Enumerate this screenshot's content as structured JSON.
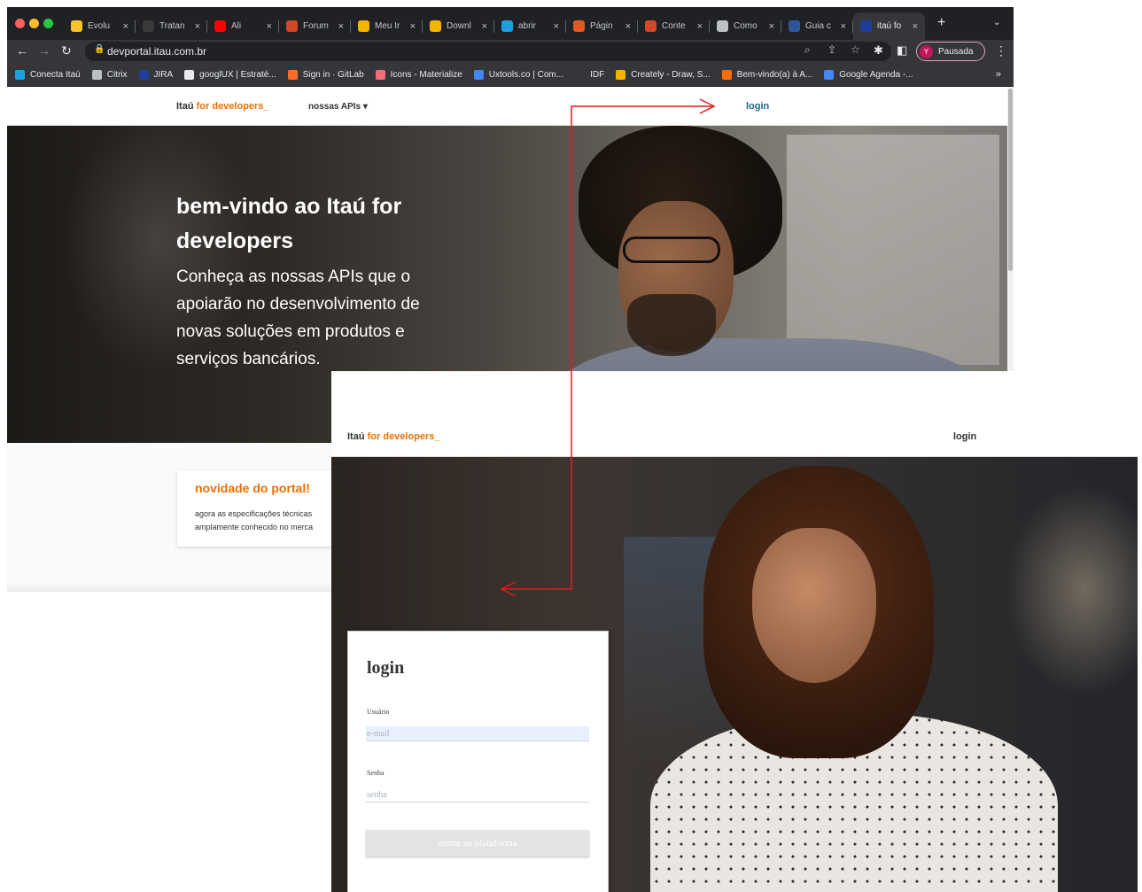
{
  "browser": {
    "tabs": [
      {
        "title": "Evolu",
        "favicon": "#f7c52b",
        "active": false
      },
      {
        "title": "Tratan",
        "favicon": "#3a3a3a",
        "active": false
      },
      {
        "title": "Ali",
        "favicon": "#ff0000",
        "active": false
      },
      {
        "title": "Forum",
        "favicon": "#d24726",
        "active": false
      },
      {
        "title": "Meu Ir",
        "favicon": "#f4b400",
        "active": false
      },
      {
        "title": "Downl",
        "favicon": "#f4b400",
        "active": false
      },
      {
        "title": "abrir",
        "favicon": "#1ba1e2",
        "active": false
      },
      {
        "title": "Págin",
        "favicon": "#e25822",
        "active": false
      },
      {
        "title": "Conte",
        "favicon": "#d24726",
        "active": false
      },
      {
        "title": "Como",
        "favicon": "#bdc1c6",
        "active": false
      },
      {
        "title": "Guia c",
        "favicon": "#2b579a",
        "active": false
      },
      {
        "title": "itaú fo",
        "favicon": "#1d3e9b",
        "active": true
      }
    ],
    "close_glyph": "×",
    "new_tab_glyph": "+",
    "tab_menu_glyph": "⌄",
    "url": "devportal.itau.com.br",
    "profile_initial": "Y",
    "profile_label": "Pausada",
    "bookmarks": [
      {
        "label": "Conecta Itaú",
        "color": "#1ba1e2"
      },
      {
        "label": "Citrix",
        "color": "#bdc1c6"
      },
      {
        "label": "JIRA",
        "color": "#1d3e9b"
      },
      {
        "label": "googlUX | Estraté...",
        "color": "#e8eaed"
      },
      {
        "label": "Sign in · GitLab",
        "color": "#fc6d26"
      },
      {
        "label": "Icons - Materialize",
        "color": "#ee6e73"
      },
      {
        "label": "Uxtools.co | Com...",
        "color": "#4285f4"
      },
      {
        "label": "IDF",
        "color": "#35363a"
      },
      {
        "label": "Creately - Draw, S...",
        "color": "#f4b400"
      },
      {
        "label": "Bem-vindo(a) à A...",
        "color": "#ff6d00"
      },
      {
        "label": "Google Agenda -...",
        "color": "#4285f4"
      }
    ],
    "bookmarks_more": "»"
  },
  "site": {
    "brand_prefix": "Itaú",
    "brand_suffix": "for developers_",
    "nav_apis": "nossas APIs ▾",
    "login_link": "login",
    "hero_title": "bem-vindo ao Itaú for developers",
    "hero_subtitle": "Conheça as nossas APIs que o apoiarão no desenvolvimento de novas soluções em produtos e serviços bancários.",
    "news_title": "novidade do portal!",
    "news_line1": "agora as especificações técnicas",
    "news_line2": "amplamente conhecido no merca"
  },
  "login_page": {
    "brand_prefix": "Itaú",
    "brand_suffix": "for developers_",
    "login_link": "login",
    "card_title": "login",
    "user_label": "Usuário",
    "user_placeholder": "e-mail",
    "password_label": "Senha",
    "password_placeholder": "senha",
    "submit_label": "entrar na plataforma"
  },
  "colors": {
    "itau_orange": "#ec7000",
    "login_link_blue": "#1d6a8c",
    "annotation_red": "#e31b1b"
  }
}
